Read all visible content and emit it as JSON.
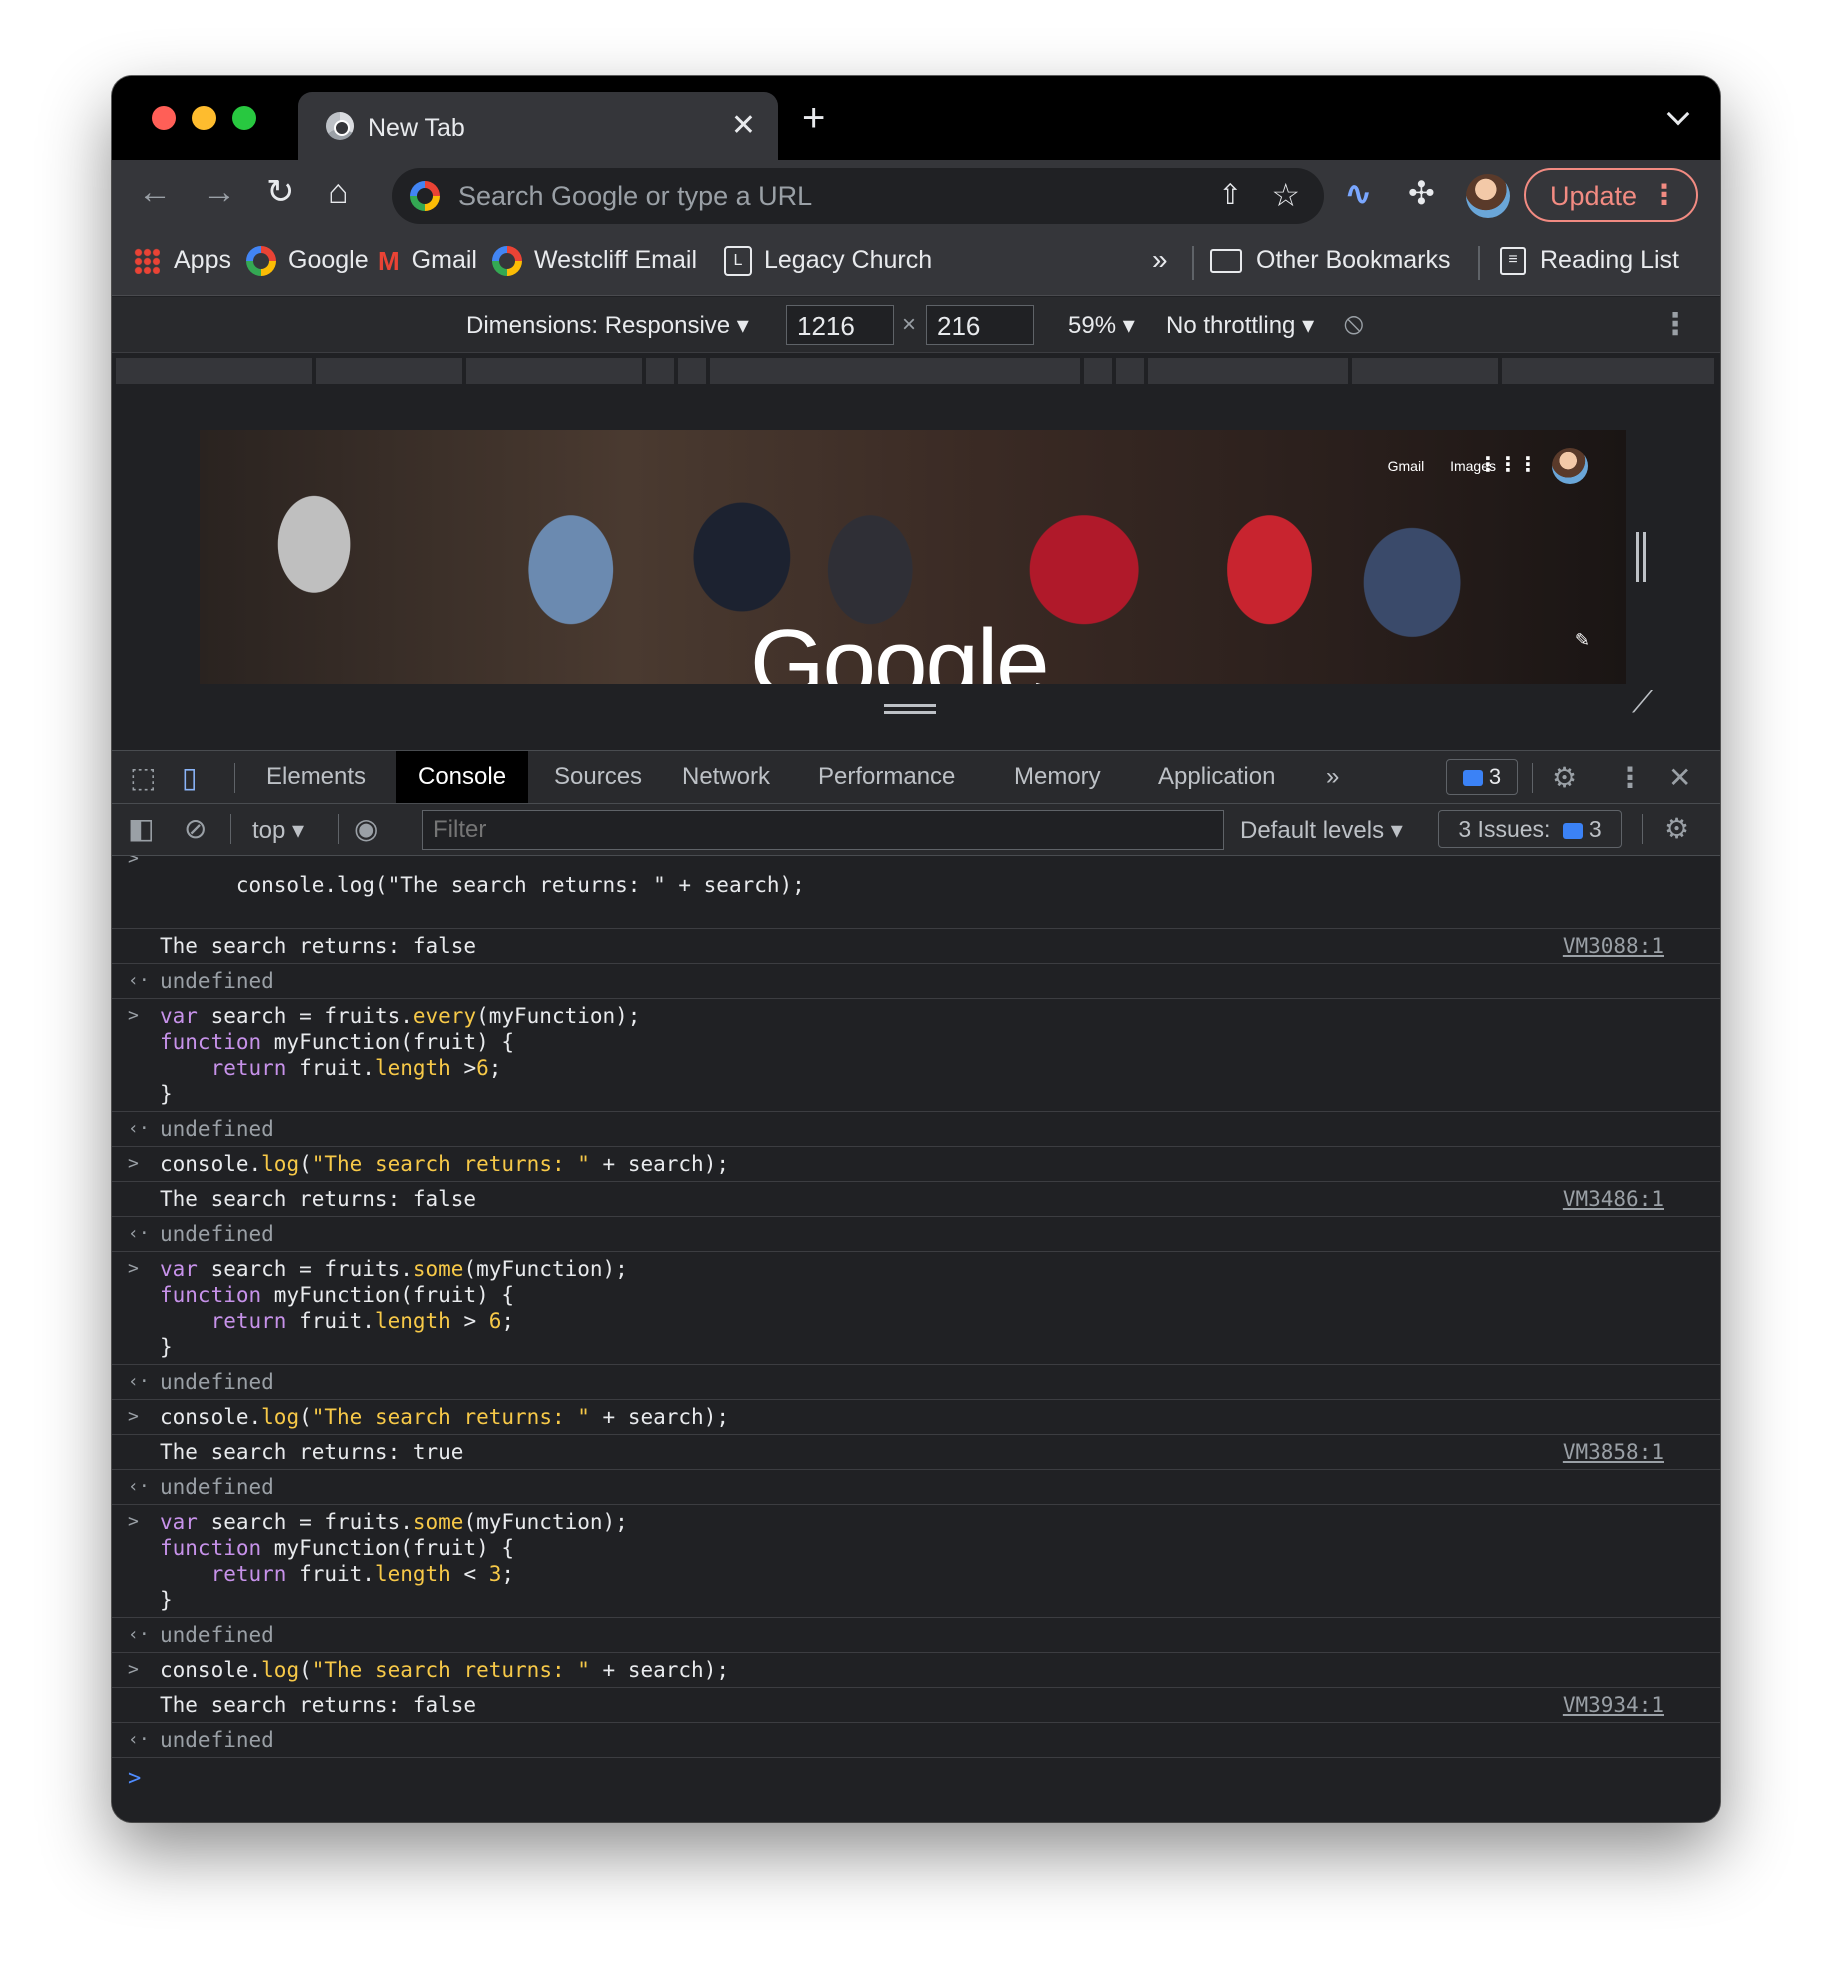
{
  "browser": {
    "tab_title": "New Tab",
    "tab_close": "✕",
    "new_tab": "+",
    "omnibox_placeholder": "Search Google or type a URL",
    "update_label": "Update"
  },
  "bookmarks": {
    "items": [
      {
        "label": "Apps",
        "icon": "apps-grid-icon"
      },
      {
        "label": "Google",
        "icon": "google-icon"
      },
      {
        "label": "Gmail",
        "icon": "gmail-icon"
      },
      {
        "label": "Westcliff Email",
        "icon": "google-icon"
      },
      {
        "label": "Legacy Church",
        "icon": "legacy-church-icon"
      }
    ],
    "more": "»",
    "other": "Other Bookmarks",
    "reading_list": "Reading List"
  },
  "device_toolbar": {
    "dimensions": "Dimensions: Responsive ▾",
    "width": "1216",
    "times": "×",
    "height": "216",
    "zoom": "59% ▾",
    "throttling": "No throttling ▾"
  },
  "page_preview": {
    "links": [
      "Gmail",
      "Images"
    ],
    "logo": "Google"
  },
  "devtools": {
    "tabs": [
      "Elements",
      "Console",
      "Sources",
      "Network",
      "Performance",
      "Memory",
      "Application"
    ],
    "active_tab": "Console",
    "more_tabs": "»",
    "message_count": "3",
    "context": "top ▾",
    "filter_placeholder": "Filter",
    "levels": "Default levels ▾",
    "issues_label": "3 Issues:",
    "issues_count": "3"
  },
  "console": {
    "partial_top": "console.log(\"The search returns: \" + search);",
    "entries": [
      {
        "out": "The search returns: false",
        "src": "VM3088:1"
      },
      {
        "ret": "undefined"
      },
      {
        "code": [
          "var search = fruits.every(myFunction);",
          "function myFunction(fruit) {",
          "    return fruit.length >6;",
          "}"
        ]
      },
      {
        "ret": "undefined"
      },
      {
        "code": [
          "console.log(\"The search returns: \" + search);"
        ]
      },
      {
        "out": "The search returns: false",
        "src": "VM3486:1"
      },
      {
        "ret": "undefined"
      },
      {
        "code": [
          "var search = fruits.some(myFunction);",
          "function myFunction(fruit) {",
          "    return fruit.length > 6;",
          "}"
        ]
      },
      {
        "ret": "undefined"
      },
      {
        "code": [
          "console.log(\"The search returns: \" + search);"
        ]
      },
      {
        "out": "The search returns: true",
        "src": "VM3858:1"
      },
      {
        "ret": "undefined"
      },
      {
        "code": [
          "var search = fruits.some(myFunction);",
          "function myFunction(fruit) {",
          "    return fruit.length < 3;",
          "}"
        ]
      },
      {
        "ret": "undefined"
      },
      {
        "code": [
          "console.log(\"The search returns: \" + search);"
        ]
      },
      {
        "out": "The search returns: false",
        "src": "VM3934:1"
      },
      {
        "ret": "undefined"
      }
    ]
  },
  "colors": {
    "accent_update": "#f28b82",
    "keyword": "#c792ea",
    "method": "#f7c948",
    "prompt": "#4f8cff"
  }
}
